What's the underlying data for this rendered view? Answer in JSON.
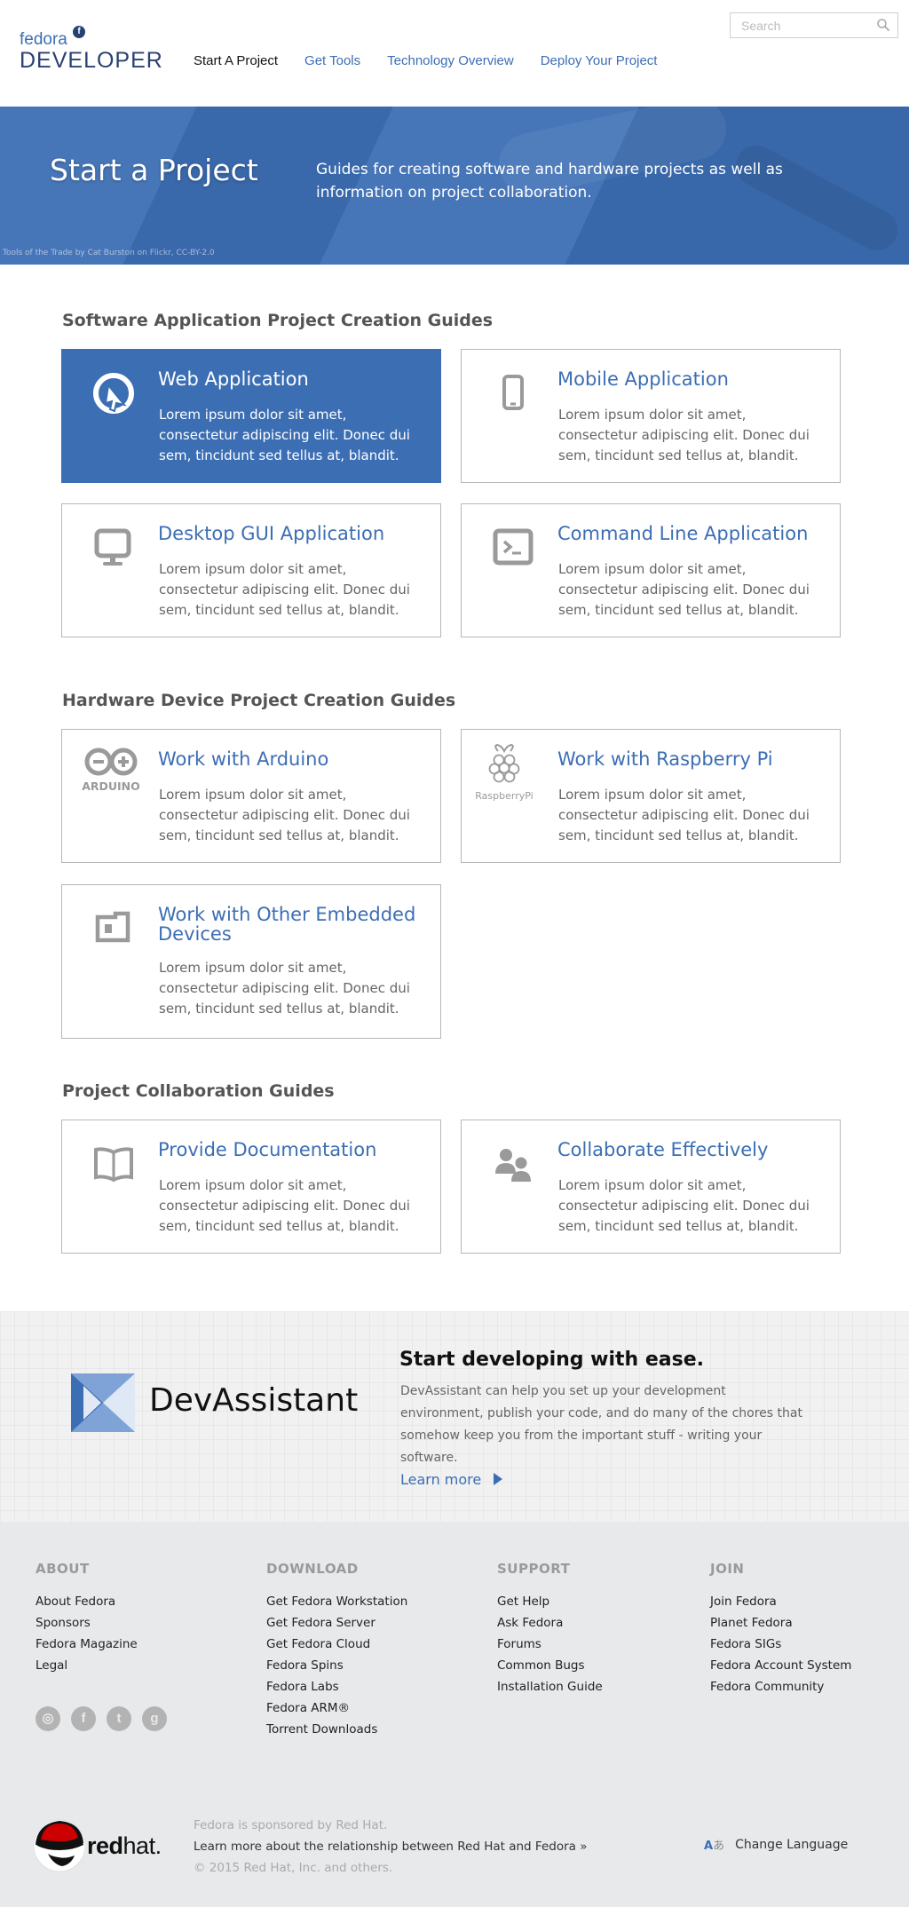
{
  "header": {
    "logo_top": "fedora",
    "logo_bottom": "DEVELOPER",
    "nav": [
      {
        "label": "Start A Project",
        "active": true
      },
      {
        "label": "Get Tools",
        "active": false
      },
      {
        "label": "Technology Overview",
        "active": false
      },
      {
        "label": "Deploy Your Project",
        "active": false
      }
    ],
    "search_placeholder": "Search",
    "search_icon": "search-icon"
  },
  "hero": {
    "title": "Start a Project",
    "description": "Guides for creating software and hardware projects as well as information on project collaboration.",
    "credit": "Tools of the Trade by Cat Burston on Flickr, CC-BY-2.0"
  },
  "sections": [
    {
      "title": "Software Application Project Creation Guides",
      "cards": [
        {
          "title": "Web Application",
          "icon": "globe-cursor-icon",
          "featured": true,
          "text": "Lorem ipsum dolor sit amet, consectetur adipiscing elit. Donec dui sem, tincidunt sed tellus at, blandit."
        },
        {
          "title": "Mobile Application",
          "icon": "mobile-phone-icon",
          "featured": false,
          "text": "Lorem ipsum dolor sit amet, consectetur adipiscing elit. Donec dui sem, tincidunt sed tellus at, blandit."
        },
        {
          "title": "Desktop GUI Application",
          "icon": "desktop-monitor-icon",
          "featured": false,
          "text": "Lorem ipsum dolor sit amet, consectetur adipiscing elit. Donec dui sem, tincidunt sed tellus at, blandit."
        },
        {
          "title": "Command Line Application",
          "icon": "terminal-icon",
          "featured": false,
          "text": "Lorem ipsum dolor sit amet, consectetur adipiscing elit. Donec dui sem, tincidunt sed tellus at, blandit."
        }
      ]
    },
    {
      "title": "Hardware Device Project Creation Guides",
      "cards": [
        {
          "title": "Work with Arduino",
          "icon": "arduino-logo-icon",
          "icon_text": "ARDUINO",
          "featured": false,
          "text": "Lorem ipsum dolor sit amet, consectetur adipiscing elit. Donec dui sem, tincidunt sed tellus at, blandit."
        },
        {
          "title": "Work with Raspberry Pi",
          "icon": "raspberry-pi-logo-icon",
          "icon_text": "RaspberryPi",
          "featured": false,
          "text": "Lorem ipsum dolor sit amet, consectetur adipiscing elit. Donec dui sem, tincidunt sed tellus at, blandit."
        },
        {
          "title": "Work with Other Embedded Devices",
          "icon": "embedded-board-icon",
          "featured": false,
          "text": "Lorem ipsum dolor sit amet, consectetur adipiscing elit. Donec dui sem, tincidunt sed tellus at, blandit."
        }
      ]
    },
    {
      "title": "Project Collaboration Guides",
      "cards": [
        {
          "title": "Provide Documentation",
          "icon": "open-book-icon",
          "featured": false,
          "text": "Lorem ipsum dolor sit amet, consectetur adipiscing elit. Donec dui sem, tincidunt sed tellus at, blandit."
        },
        {
          "title": "Collaborate Effectively",
          "icon": "people-icon",
          "featured": false,
          "text": "Lorem ipsum dolor sit amet, consectetur adipiscing elit. Donec dui sem, tincidunt sed tellus at, blandit."
        }
      ]
    }
  ],
  "devassistant": {
    "logo_text": "DevAssistant",
    "heading": "Start developing with ease.",
    "text": "DevAssistant can help you set up your development environment, publish your code, and do many of the chores that somehow keep you from the important stuff - writing your software.",
    "link": "Learn more"
  },
  "footer": {
    "columns": [
      {
        "heading": "ABOUT",
        "links": [
          "About Fedora",
          "Sponsors",
          "Fedora Magazine",
          "Legal"
        ]
      },
      {
        "heading": "DOWNLOAD",
        "links": [
          "Get Fedora Workstation",
          "Get Fedora Server",
          "Get Fedora Cloud",
          "Fedora Spins",
          "Fedora Labs",
          "Fedora ARM®",
          "Torrent Downloads"
        ]
      },
      {
        "heading": "SUPPORT",
        "links": [
          "Get Help",
          "Ask Fedora",
          "Forums",
          "Common Bugs",
          "Installation Guide"
        ]
      },
      {
        "heading": "JOIN",
        "links": [
          "Join Fedora",
          "Planet Fedora",
          "Fedora SIGs",
          "Fedora Account System",
          "Fedora Community"
        ]
      }
    ],
    "social": [
      {
        "icon": "rss-icon",
        "glyph": "◎"
      },
      {
        "icon": "facebook-icon",
        "glyph": "f"
      },
      {
        "icon": "twitter-icon",
        "glyph": "t"
      },
      {
        "icon": "google-plus-icon",
        "glyph": "g"
      }
    ],
    "redhat": {
      "word_bold": "red",
      "word_light": "hat."
    },
    "sponsor_line": "Fedora is sponsored by Red Hat.",
    "learn_line": "Learn more about the relationship between Red Hat and Fedora »",
    "copyright": "© 2015 Red Hat, Inc. and others.",
    "change_language": "Change Language",
    "language_icon_glyphs": {
      "latin": "A",
      "kana": "あ"
    }
  },
  "colors": {
    "accent": "#3c6eb4",
    "dark_blue": "#294172",
    "footer_bg": "#e8e9ea",
    "icon_gray": "#9a9a9a"
  }
}
